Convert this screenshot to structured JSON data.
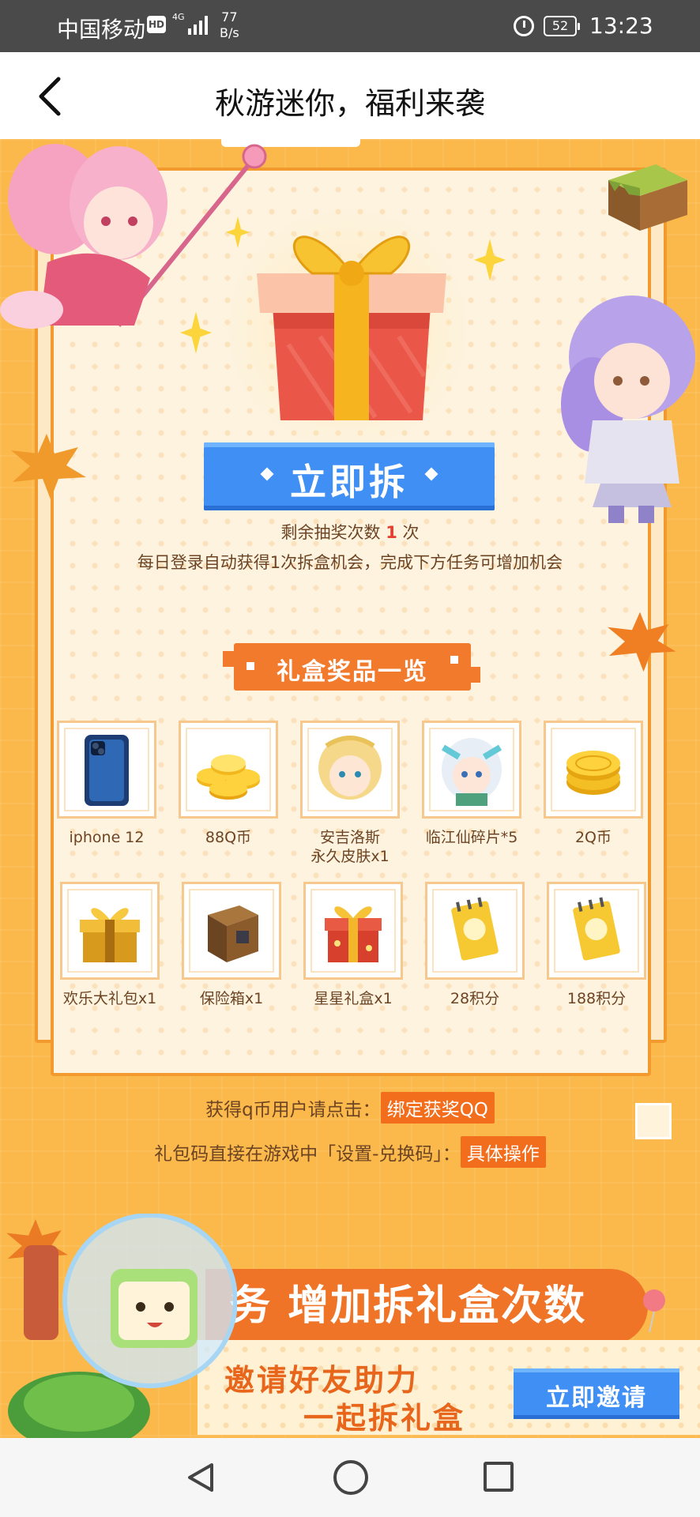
{
  "status_bar": {
    "carrier": "中国移动",
    "hd": "HD",
    "network": "4G",
    "speed_value": "77",
    "speed_unit": "B/s",
    "battery": "52",
    "time": "13:23"
  },
  "header": {
    "title": "秋游迷你，福利来袭"
  },
  "draw": {
    "open_button_label": "立即拆",
    "remaining_prefix": "剩余抽奖次数",
    "remaining_count": "1",
    "remaining_suffix": "次",
    "daily_note": "每日登录自动获得1次拆盒机会，完成下方任务可增加机会"
  },
  "prizes": {
    "section_title": "礼盒奖品一览",
    "items": [
      {
        "label": "iphone 12",
        "icon": "phone-icon"
      },
      {
        "label": "88Q币",
        "icon": "coins-pile-icon"
      },
      {
        "label": "安吉洛斯\n永久皮肤x1",
        "icon": "angel-skin-avatar"
      },
      {
        "label": "临江仙碎片*5",
        "icon": "character-shard-avatar"
      },
      {
        "label": "2Q币",
        "icon": "coin-stack-icon"
      },
      {
        "label": "欢乐大礼包x1",
        "icon": "gold-gift-icon"
      },
      {
        "label": "保险箱x1",
        "icon": "wooden-chest-icon"
      },
      {
        "label": "星星礼盒x1",
        "icon": "red-gift-icon"
      },
      {
        "label": "28积分",
        "icon": "points-card-icon"
      },
      {
        "label": "188积分",
        "icon": "points-card-icon"
      }
    ]
  },
  "claim": {
    "qcoin_text": "获得q币用户请点击：",
    "qcoin_button": "绑定获奖QQ",
    "code_text": "礼包码直接在游戏中「设置-兑换码」：",
    "code_button": "具体操作"
  },
  "promo": {
    "task_banner": "务 增加拆礼盒次数",
    "invite_line1": "邀请好友助力",
    "invite_line2": "一起拆礼盒",
    "invite_button": "立即邀请"
  },
  "colors": {
    "background": "#fbb84b",
    "accent_orange": "#f26d1c",
    "button_blue": "#3f8ff5",
    "count_red": "#e53d2e"
  }
}
